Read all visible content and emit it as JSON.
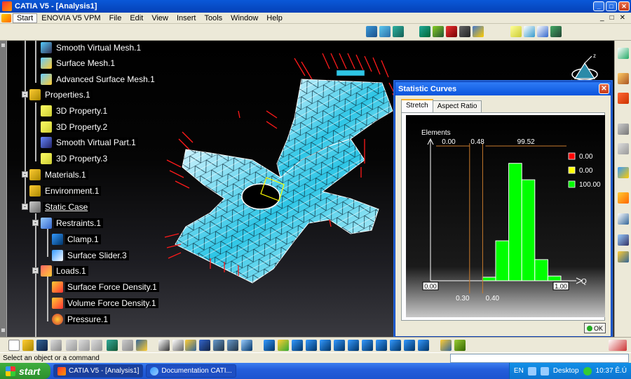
{
  "window": {
    "title": "CATIA V5 - [Analysis1]",
    "min_glyph": "_",
    "max_glyph": "□",
    "close_glyph": "✕"
  },
  "menubar": {
    "items": [
      "Start",
      "ENOVIA V5 VPM",
      "File",
      "Edit",
      "View",
      "Insert",
      "Tools",
      "Window",
      "Help"
    ],
    "mdi": [
      "_",
      "□",
      "✕"
    ]
  },
  "tree": {
    "nodes": [
      {
        "label": "Smooth Virtual Mesh.1",
        "icon": "smooth-mesh-icon"
      },
      {
        "label": "Surface Mesh.1",
        "icon": "surface-mesh-icon"
      },
      {
        "label": "Advanced Surface Mesh.1",
        "icon": "advanced-mesh-icon"
      },
      {
        "label": "Properties.1",
        "icon": "properties-folder-icon"
      },
      {
        "label": "3D Property.1",
        "icon": "cube-property-icon"
      },
      {
        "label": "3D Property.2",
        "icon": "cube-property-icon"
      },
      {
        "label": "Smooth Virtual Part.1",
        "icon": "virtual-part-icon"
      },
      {
        "label": "3D Property.3",
        "icon": "cube-property-icon"
      },
      {
        "label": "Materials.1",
        "icon": "materials-folder-icon"
      },
      {
        "label": "Environment.1",
        "icon": "environment-folder-icon"
      },
      {
        "label": "Static Case",
        "icon": "static-case-icon"
      },
      {
        "label": "Restraints.1",
        "icon": "restraints-icon"
      },
      {
        "label": "Clamp.1",
        "icon": "clamp-icon"
      },
      {
        "label": "Surface Slider.3",
        "icon": "surface-slider-icon"
      },
      {
        "label": "Loads.1",
        "icon": "loads-icon"
      },
      {
        "label": "Surface Force Density.1",
        "icon": "surface-force-icon"
      },
      {
        "label": "Volume Force Density.1",
        "icon": "volume-force-icon"
      },
      {
        "label": "Pressure.1",
        "icon": "pressure-icon"
      }
    ]
  },
  "dialog": {
    "title": "Statistic Curves",
    "close_glyph": "✕",
    "tabs": [
      "Stretch",
      "Aspect Ratio"
    ],
    "ok_label": "OK"
  },
  "chart_data": {
    "type": "bar",
    "ylabel": "Elements",
    "xlabel": "Q",
    "xlim": [
      0.0,
      1.0
    ],
    "x_tick_labels": [
      "0.00",
      "1.00"
    ],
    "thresholds": [
      0.3,
      0.4
    ],
    "threshold_labels": [
      "0.30",
      "0.40"
    ],
    "region_percents": [
      "0.00",
      "0.48",
      "99.52"
    ],
    "legend": [
      {
        "color": "#ff0000",
        "value": "0.00"
      },
      {
        "color": "#ffff00",
        "value": "0.00"
      },
      {
        "color": "#00ff00",
        "value": "100.00"
      }
    ],
    "bins": [
      {
        "x0": 0.4,
        "x1": 0.5,
        "value": 3
      },
      {
        "x0": 0.5,
        "x1": 0.6,
        "value": 34
      },
      {
        "x0": 0.6,
        "x1": 0.7,
        "value": 100
      },
      {
        "x0": 0.7,
        "x1": 0.8,
        "value": 86
      },
      {
        "x0": 0.8,
        "x1": 0.9,
        "value": 18
      },
      {
        "x0": 0.9,
        "x1": 1.0,
        "value": 4
      }
    ],
    "ylim": [
      0,
      110
    ]
  },
  "statusbar": {
    "text": "Select an object or a command"
  },
  "taskbar": {
    "start_label": "start",
    "tasks": [
      "CATIA V5 - [Analysis1]",
      "Documentation CATI..."
    ],
    "lang": "EN",
    "desktop_label": "Desktop",
    "clock": "10:37 Ê.Ú"
  },
  "colors": {
    "mesh_fill": "#27c8e8",
    "load_arrow": "#ff1a1a",
    "bar_fill": "#00ff00",
    "threshold_line": "#c87a2c"
  }
}
